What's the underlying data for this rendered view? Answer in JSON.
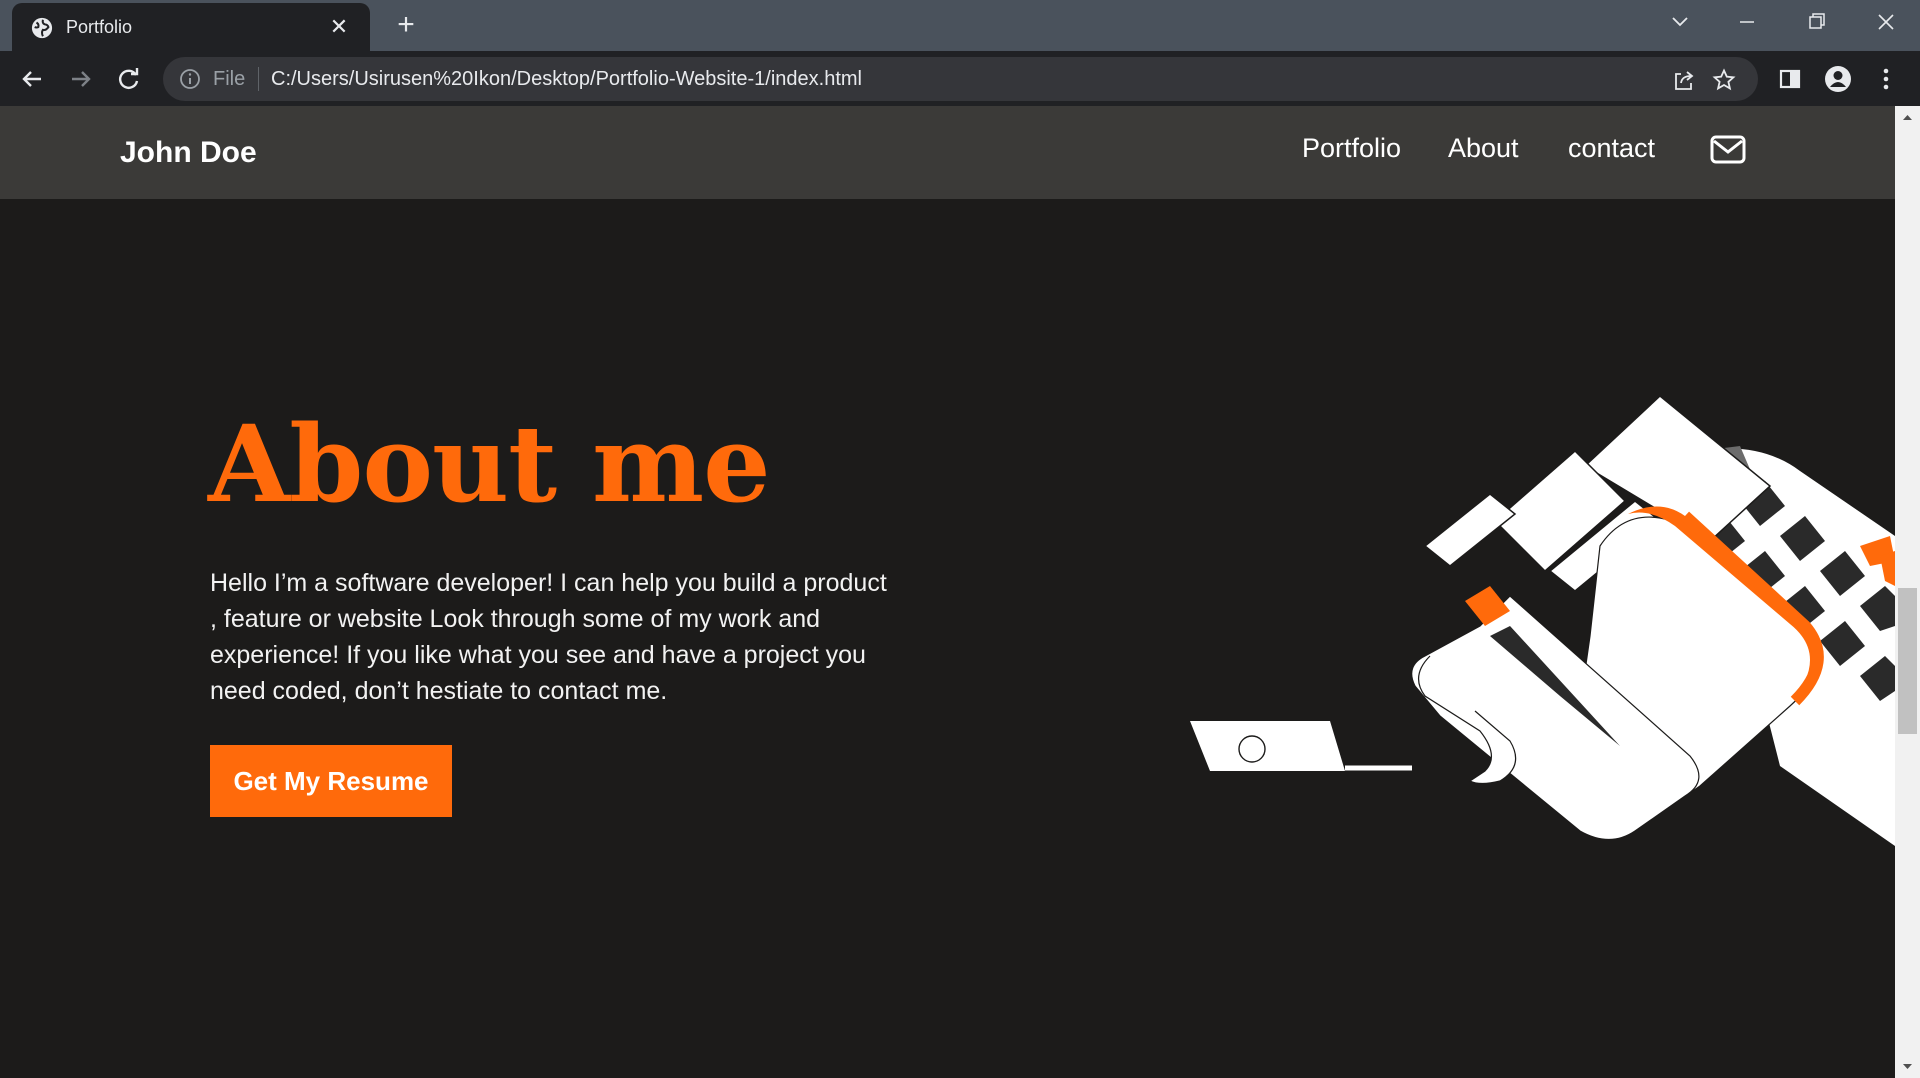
{
  "browser": {
    "tab_title": "Portfolio",
    "tab_close": "✕",
    "new_tab": "+",
    "omnibox_scheme": "File",
    "url": "C:/Users/Usirusen%20Ikon/Desktop/Portfolio-Website-1/index.html"
  },
  "site": {
    "brand": "John Doe",
    "nav": [
      "Portfolio",
      "About",
      "contact"
    ]
  },
  "hero": {
    "title": "About me",
    "body": "Hello I’m a software developer! I can help you build a product , feature or website Look through some of my work and experience! If you like what you see and have a project you need coded, don’t hestiate to contact me.",
    "button": "Get My Resume"
  },
  "colors": {
    "accent": "#ff6a0b",
    "background": "#1c1b1a",
    "header": "#3b3a38"
  }
}
